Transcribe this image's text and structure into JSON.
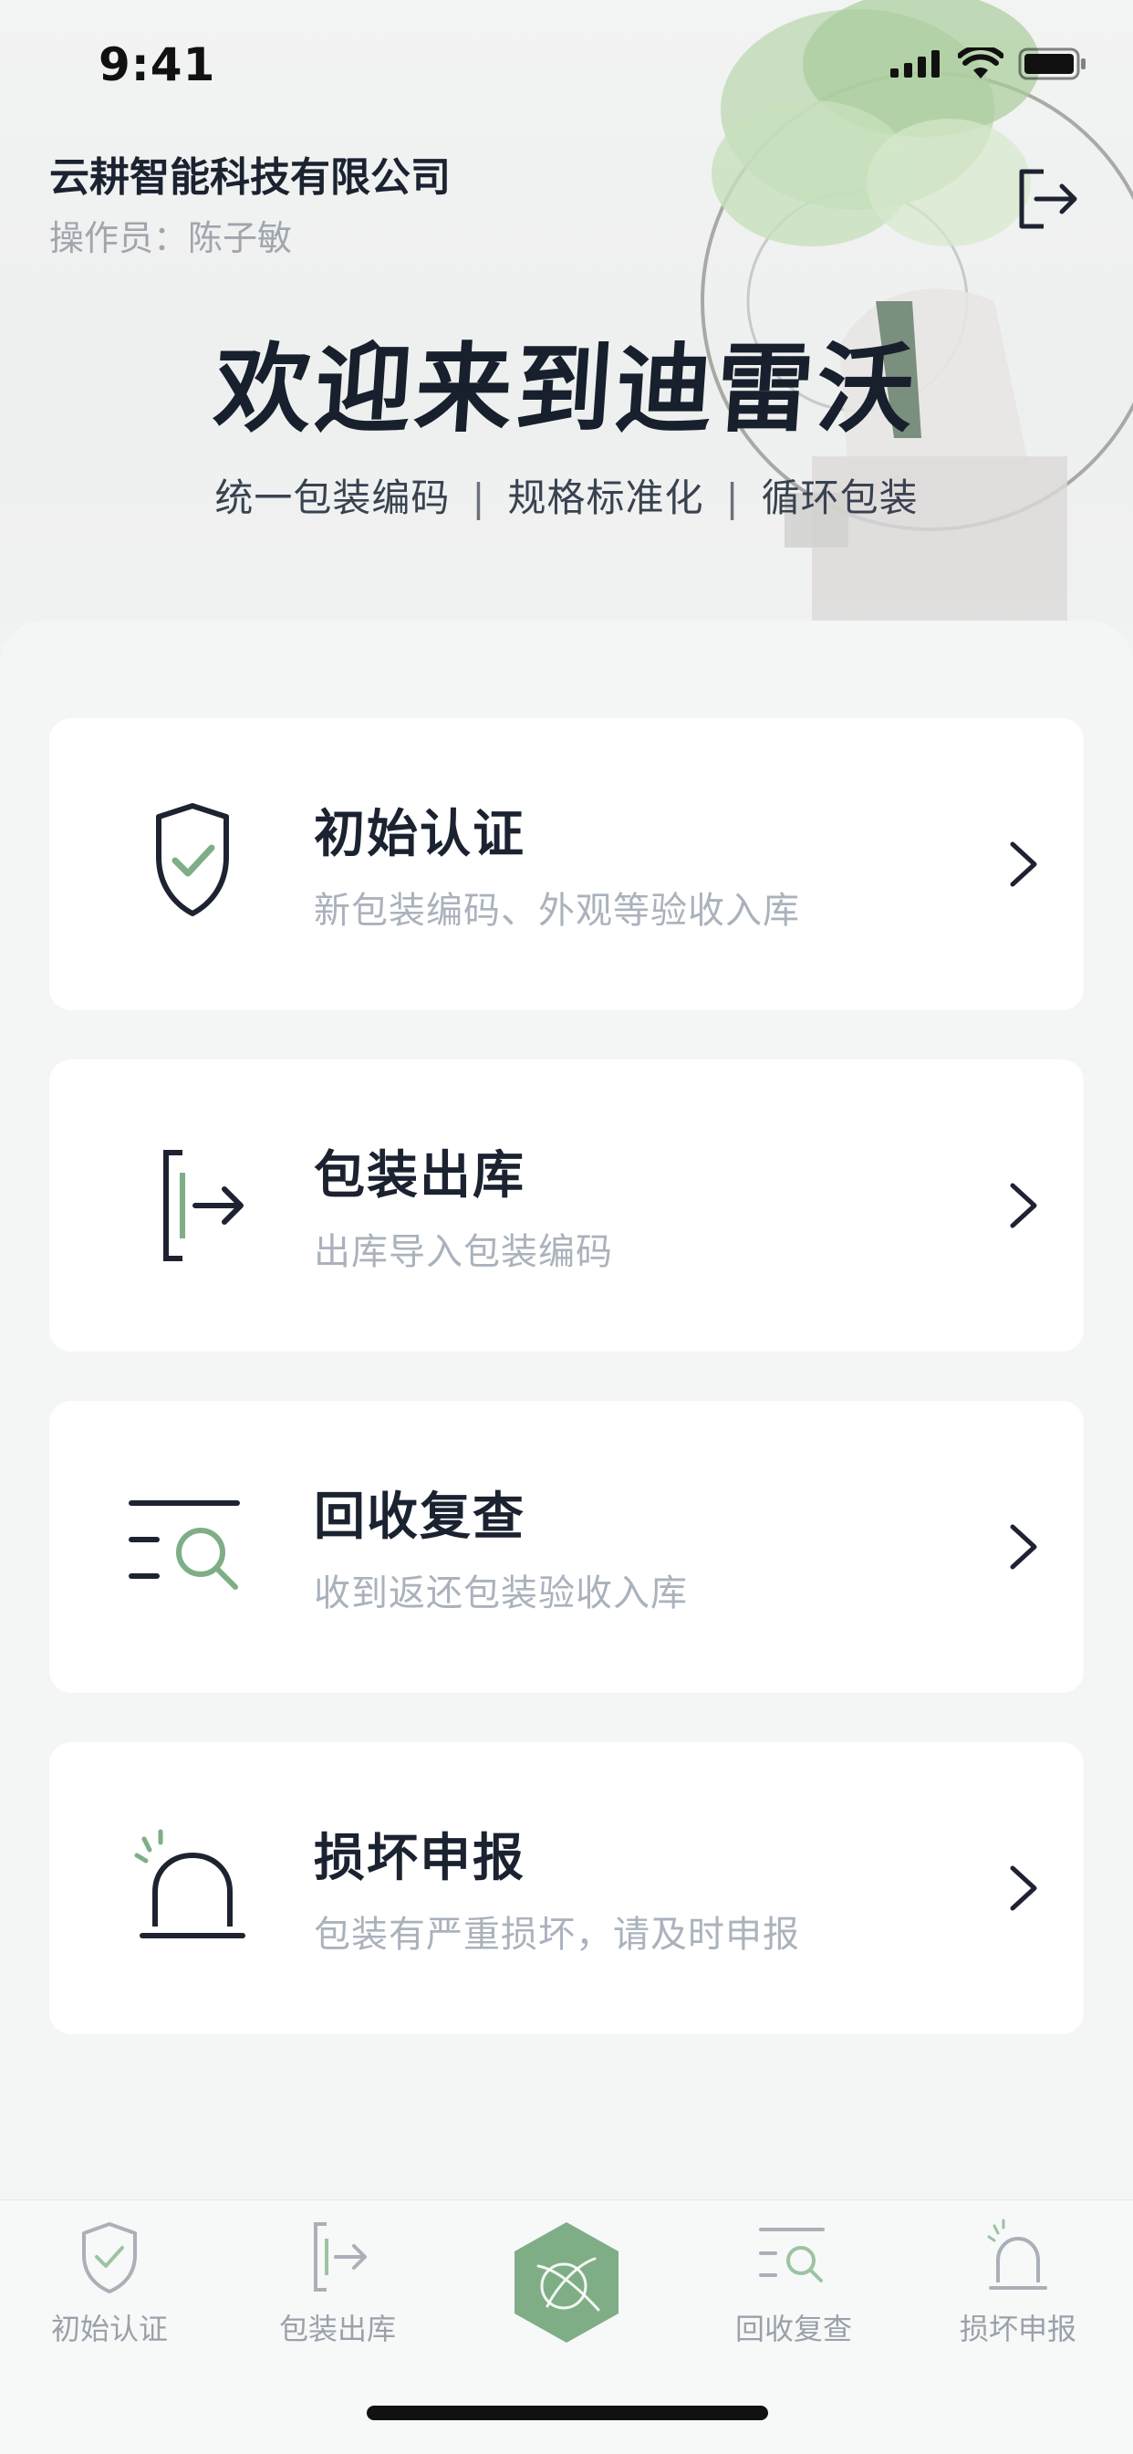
{
  "status_bar": {
    "time": "9:41"
  },
  "header": {
    "company": "云耕智能科技有限公司",
    "operator": "操作员：陈子敏",
    "logout_icon": "logout-icon",
    "welcome": "欢迎来到迪雷沃",
    "slogans": [
      "统一包装编码",
      "规格标准化",
      "循环包装"
    ],
    "separator": "|"
  },
  "menu": [
    {
      "title": "初始认证",
      "desc": "新包装编码、外观等验收入库",
      "icon": "shield-check-icon"
    },
    {
      "title": "包装出库",
      "desc": "出库导入包装编码",
      "icon": "export-icon"
    },
    {
      "title": "回收复查",
      "desc": "收到返还包装验收入库",
      "icon": "search-list-icon"
    },
    {
      "title": "损坏申报",
      "desc": "包装有严重损坏，请及时申报",
      "icon": "alarm-icon"
    }
  ],
  "tabbar": [
    {
      "label": "初始认证",
      "icon": "shield-check-icon"
    },
    {
      "label": "包装出库",
      "icon": "export-icon"
    },
    {
      "label": "",
      "icon": "hexagon-logo-icon"
    },
    {
      "label": "回收复查",
      "icon": "search-list-icon"
    },
    {
      "label": "损坏申报",
      "icon": "alarm-icon"
    }
  ],
  "colors": {
    "accent": "#7fae86",
    "text": "#1b2230",
    "muted": "#aab2bc",
    "tab_muted": "#9aa1a9"
  }
}
